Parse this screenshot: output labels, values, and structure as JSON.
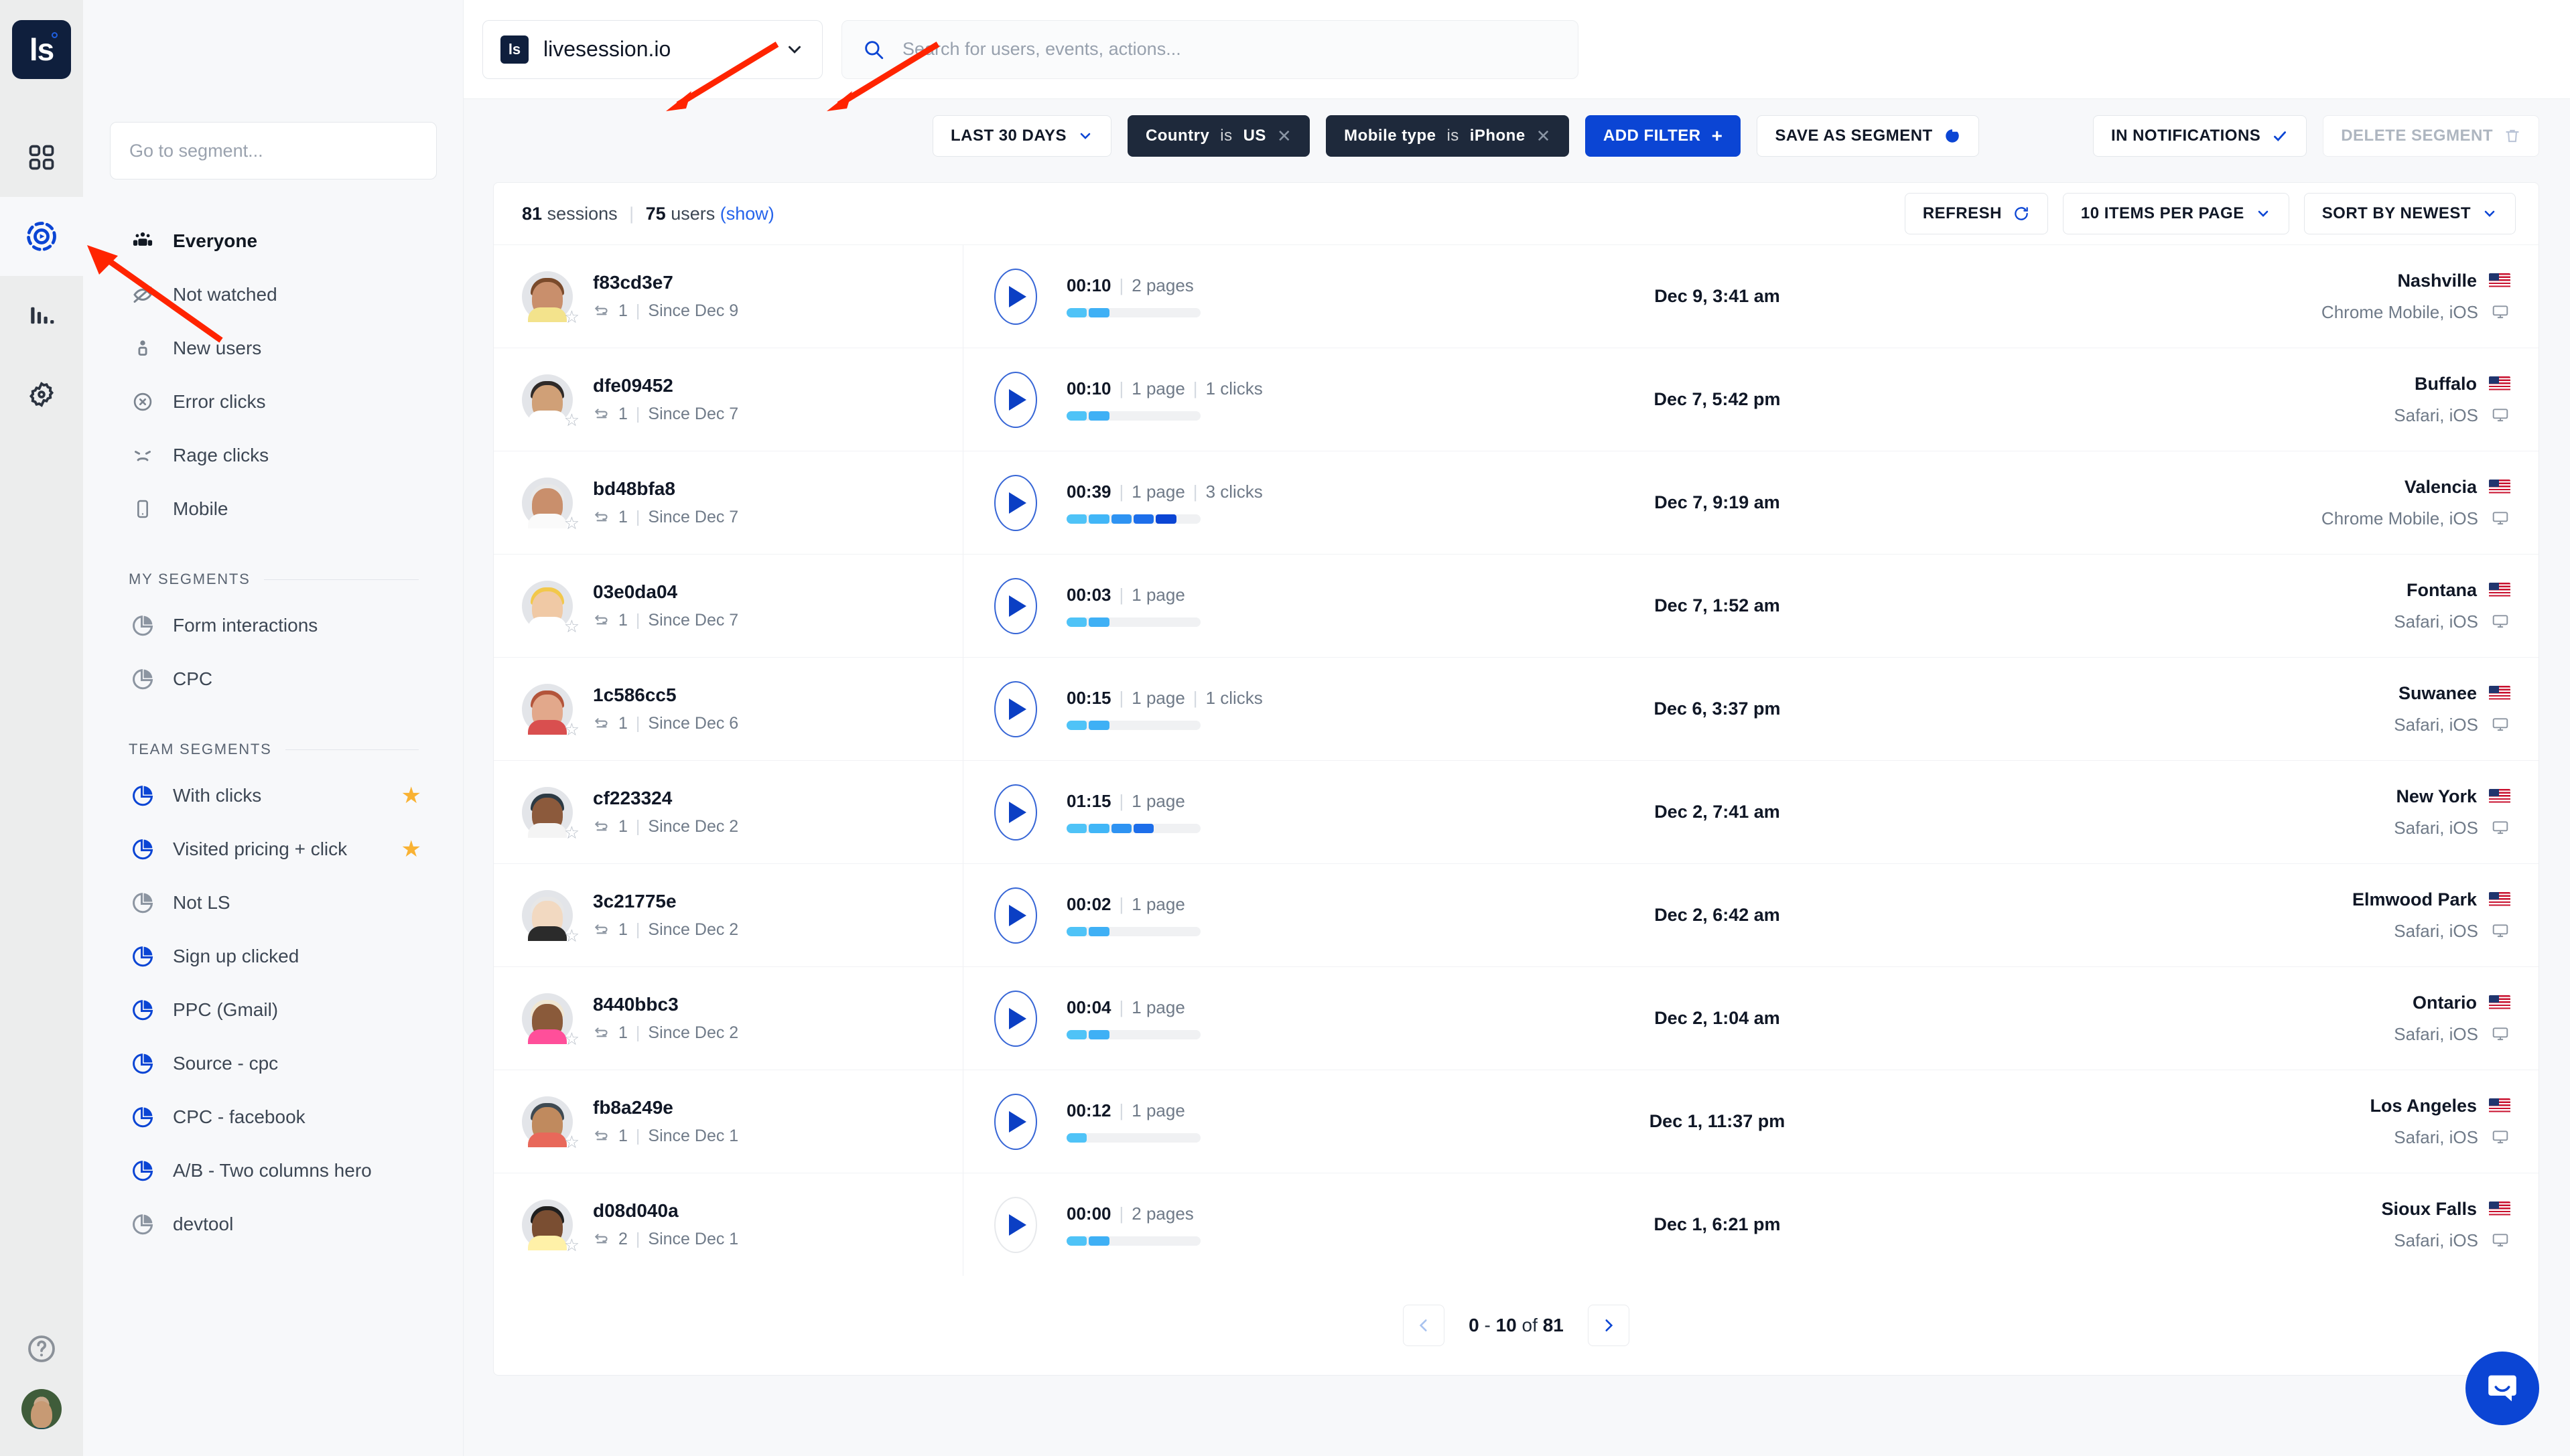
{
  "rail": {
    "logo_text": "ls",
    "items": [
      {
        "name": "dashboard-icon",
        "active": false
      },
      {
        "name": "sessions-icon",
        "active": true
      },
      {
        "name": "analytics-icon",
        "active": false
      },
      {
        "name": "settings-icon",
        "active": false
      }
    ],
    "help_icon": "help-icon",
    "avatar": "user-avatar"
  },
  "topbar": {
    "site_badge": "ls",
    "site_name": "livesession.io",
    "search_placeholder": "Search for users, events, actions..."
  },
  "sidebar": {
    "segment_search_placeholder": "Go to segment...",
    "primary": [
      {
        "label": "Everyone",
        "icon": "people-icon",
        "strong": true,
        "active": true
      },
      {
        "label": "Not watched",
        "icon": "eye-off-icon",
        "strong": false,
        "active": false
      },
      {
        "label": "New users",
        "icon": "person-icon",
        "strong": false,
        "active": false
      },
      {
        "label": "Error clicks",
        "icon": "error-circle-icon",
        "strong": false,
        "active": false
      },
      {
        "label": "Rage clicks",
        "icon": "angry-face-icon",
        "strong": false,
        "active": false
      },
      {
        "label": "Mobile",
        "icon": "mobile-icon",
        "strong": false,
        "active": false
      }
    ],
    "my_segments_title": "MY SEGMENTS",
    "my_segments": [
      {
        "label": "Form interactions",
        "icon": "pie-chart-icon",
        "accent": false,
        "starred": false
      },
      {
        "label": "CPC",
        "icon": "pie-chart-icon",
        "accent": false,
        "starred": false
      }
    ],
    "team_segments_title": "TEAM SEGMENTS",
    "team_segments": [
      {
        "label": "With clicks",
        "icon": "pie-chart-icon",
        "accent": true,
        "starred": true
      },
      {
        "label": "Visited pricing + click",
        "icon": "pie-chart-icon",
        "accent": true,
        "starred": true
      },
      {
        "label": "Not LS",
        "icon": "pie-chart-icon",
        "accent": false,
        "starred": false
      },
      {
        "label": "Sign up clicked",
        "icon": "pie-chart-icon",
        "accent": true,
        "starred": false
      },
      {
        "label": "PPC (Gmail)",
        "icon": "pie-chart-icon",
        "accent": true,
        "starred": false
      },
      {
        "label": "Source - cpc",
        "icon": "pie-chart-icon",
        "accent": true,
        "starred": false
      },
      {
        "label": "CPC - facebook",
        "icon": "pie-chart-icon",
        "accent": true,
        "starred": false
      },
      {
        "label": "A/B - Two columns hero",
        "icon": "pie-chart-icon",
        "accent": true,
        "starred": false
      },
      {
        "label": "devtool",
        "icon": "pie-chart-icon",
        "accent": false,
        "starred": false
      }
    ]
  },
  "filters": {
    "date_range": "LAST 30 DAYS",
    "chips": [
      {
        "field": "Country",
        "op": "is",
        "value": "US"
      },
      {
        "field": "Mobile type",
        "op": "is",
        "value": "iPhone"
      }
    ],
    "add_filter": "ADD FILTER",
    "save_as_segment": "SAVE AS SEGMENT",
    "in_notifications": "IN NOTIFICATIONS",
    "delete_segment": "DELETE SEGMENT"
  },
  "list_header": {
    "sessions_count": "81",
    "sessions_word": "sessions",
    "users_count": "75",
    "users_word": "users",
    "show_link": "(show)",
    "refresh": "REFRESH",
    "items_per_page": "10 ITEMS PER PAGE",
    "sort": "SORT BY NEWEST"
  },
  "sessions": [
    {
      "id": "f83cd3e7",
      "returns": "1",
      "since": "Since Dec 9",
      "duration": "00:10",
      "pages": "2 pages",
      "clicks": "",
      "date": "Dec 9, 3:41 am",
      "city": "Nashville",
      "browser": "Chrome Mobile, iOS",
      "segments": 2,
      "play_active": true,
      "colors": [
        "#4fc3f7",
        "#3fb0f5"
      ]
    },
    {
      "id": "dfe09452",
      "returns": "1",
      "since": "Since Dec 7",
      "duration": "00:10",
      "pages": "1 page",
      "clicks": "1 clicks",
      "date": "Dec 7, 5:42 pm",
      "city": "Buffalo",
      "browser": "Safari, iOS",
      "segments": 2,
      "play_active": true,
      "colors": [
        "#4fc3f7",
        "#3fb0f5"
      ]
    },
    {
      "id": "bd48bfa8",
      "returns": "1",
      "since": "Since Dec 7",
      "duration": "00:39",
      "pages": "1 page",
      "clicks": "3 clicks",
      "date": "Dec 7, 9:19 am",
      "city": "Valencia",
      "browser": "Chrome Mobile, iOS",
      "segments": 5,
      "play_active": true,
      "colors": [
        "#4fc3f7",
        "#41b6f7",
        "#2e93f2",
        "#1d6eea",
        "#0b45d4"
      ]
    },
    {
      "id": "03e0da04",
      "returns": "1",
      "since": "Since Dec 7",
      "duration": "00:03",
      "pages": "1 page",
      "clicks": "",
      "date": "Dec 7, 1:52 am",
      "city": "Fontana",
      "browser": "Safari, iOS",
      "segments": 2,
      "play_active": true,
      "colors": [
        "#4fc3f7",
        "#3fb0f5"
      ]
    },
    {
      "id": "1c586cc5",
      "returns": "1",
      "since": "Since Dec 6",
      "duration": "00:15",
      "pages": "1 page",
      "clicks": "1 clicks",
      "date": "Dec 6, 3:37 pm",
      "city": "Suwanee",
      "browser": "Safari, iOS",
      "segments": 2,
      "play_active": true,
      "colors": [
        "#4fc3f7",
        "#3fb0f5"
      ]
    },
    {
      "id": "cf223324",
      "returns": "1",
      "since": "Since Dec 2",
      "duration": "01:15",
      "pages": "1 page",
      "clicks": "",
      "date": "Dec 2, 7:41 am",
      "city": "New York",
      "browser": "Safari, iOS",
      "segments": 4,
      "play_active": true,
      "colors": [
        "#4fc3f7",
        "#41b6f7",
        "#2e93f2",
        "#1d6eea"
      ]
    },
    {
      "id": "3c21775e",
      "returns": "1",
      "since": "Since Dec 2",
      "duration": "00:02",
      "pages": "1 page",
      "clicks": "",
      "date": "Dec 2, 6:42 am",
      "city": "Elmwood Park",
      "browser": "Safari, iOS",
      "segments": 2,
      "play_active": true,
      "colors": [
        "#4fc3f7",
        "#3fb0f5"
      ]
    },
    {
      "id": "8440bbc3",
      "returns": "1",
      "since": "Since Dec 2",
      "duration": "00:04",
      "pages": "1 page",
      "clicks": "",
      "date": "Dec 2, 1:04 am",
      "city": "Ontario",
      "browser": "Safari, iOS",
      "segments": 2,
      "play_active": true,
      "colors": [
        "#4fc3f7",
        "#3fb0f5"
      ]
    },
    {
      "id": "fb8a249e",
      "returns": "1",
      "since": "Since Dec 1",
      "duration": "00:12",
      "pages": "1 page",
      "clicks": "",
      "date": "Dec 1, 11:37 pm",
      "city": "Los Angeles",
      "browser": "Safari, iOS",
      "segments": 1,
      "play_active": true,
      "colors": [
        "#4fc3f7"
      ]
    },
    {
      "id": "d08d040a",
      "returns": "2",
      "since": "Since Dec 1",
      "duration": "00:00",
      "pages": "2 pages",
      "clicks": "",
      "date": "Dec 1, 6:21 pm",
      "city": "Sioux Falls",
      "browser": "Safari, iOS",
      "segments": 2,
      "play_active": false,
      "colors": [
        "#4fc3f7",
        "#3fb0f5"
      ]
    }
  ],
  "pagination": {
    "range_start": "0",
    "range_sep": "-",
    "range_end": "10",
    "of_word": "of",
    "total": "81"
  },
  "colors": {
    "accent": "#0b45d4",
    "dark_chip": "#1e293b",
    "star": "#f9b233",
    "link": "#2563eb"
  },
  "annotations": {
    "arrow_count": 3,
    "color": "#ff2400"
  }
}
